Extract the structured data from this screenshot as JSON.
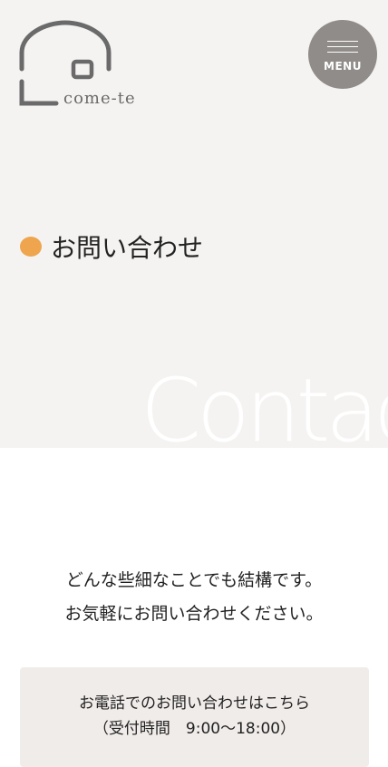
{
  "header": {
    "logo_text": "come-te",
    "menu_label": "MENU"
  },
  "hero": {
    "title": "お問い合わせ",
    "background_word": "Contact"
  },
  "intro": {
    "line1": "どんな些細なことでも結構です。",
    "line2": "お気軽にお問い合わせください。"
  },
  "phone": {
    "line1": "お電話でのお問い合わせはこちら",
    "line2": "（受付時間　9:00〜18:00）"
  },
  "colors": {
    "hero_bg": "#f5f3f1",
    "accent_dot": "#eea54e",
    "menu_bg": "#8f8c89",
    "phone_box_bg": "#f0ecea",
    "logo_gray": "#6a6a6a"
  },
  "icons": {
    "logo": "house-outline-logo-icon",
    "menu": "hamburger-menu-icon",
    "heading": "orange-dot-icon"
  }
}
